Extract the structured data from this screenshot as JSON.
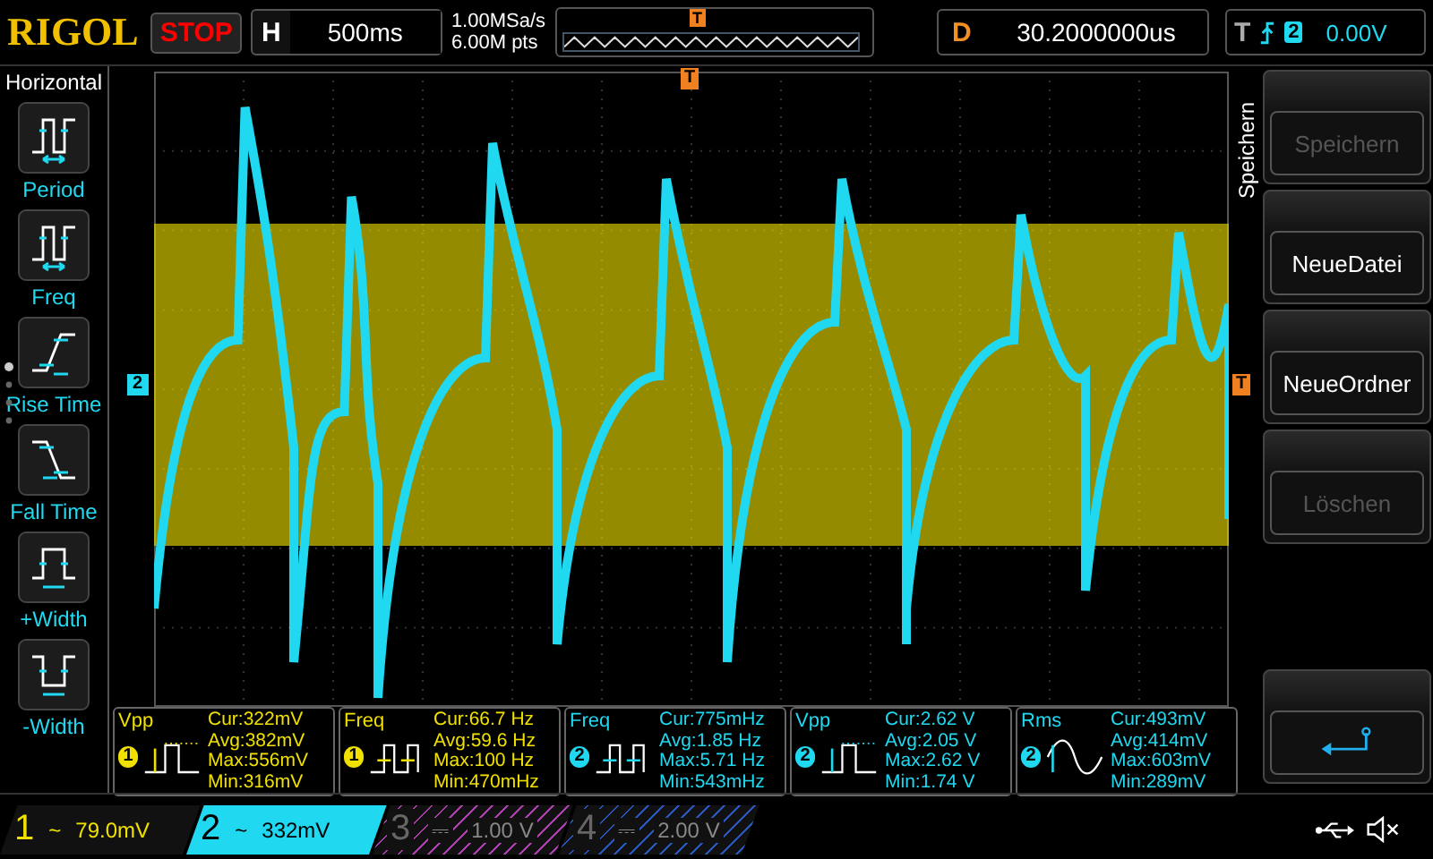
{
  "brand": "RIGOL",
  "run_state": "STOP",
  "timebase": {
    "label": "H",
    "value": "500ms"
  },
  "acquisition": {
    "sample_rate": "1.00MSa/s",
    "memory_depth": "6.00M pts"
  },
  "overview_marker": "T",
  "delay": {
    "label": "D",
    "value": "30.2000000us"
  },
  "trigger": {
    "label": "T",
    "source": "2",
    "level": "0.00V"
  },
  "left_menu": {
    "title": "Horizontal",
    "items": [
      {
        "label": "Period",
        "kind": "period"
      },
      {
        "label": "Freq",
        "kind": "freq"
      },
      {
        "label": "Rise Time",
        "kind": "rise"
      },
      {
        "label": "Fall Time",
        "kind": "fall"
      },
      {
        "label": "+Width",
        "kind": "pwidth"
      },
      {
        "label": "-Width",
        "kind": "nwidth"
      }
    ]
  },
  "screen_markers": {
    "channel": "2",
    "trigger_top": "T",
    "trigger_level": "T"
  },
  "right_menu": {
    "title": "Speichern",
    "buttons": [
      {
        "kind": "text",
        "label": "Speichern",
        "disabled": true
      },
      {
        "kind": "text",
        "label": "NeueDatei",
        "disabled": false
      },
      {
        "kind": "text",
        "label": "NeueOrdner",
        "disabled": false
      },
      {
        "kind": "text",
        "label": "Löschen",
        "disabled": true
      },
      {
        "kind": "back"
      }
    ]
  },
  "measurements": [
    {
      "name": "Vpp",
      "channel": "1",
      "color": "#f0e000",
      "kind": "pulse",
      "lines": [
        "Cur:322mV",
        "Avg:382mV",
        "Max:556mV",
        "Min:316mV"
      ]
    },
    {
      "name": "Freq",
      "channel": "1",
      "color": "#f0e000",
      "kind": "period",
      "lines": [
        "Cur:66.7 Hz",
        "Avg:59.6 Hz",
        "Max:100 Hz",
        "Min:470mHz"
      ]
    },
    {
      "name": "Freq",
      "channel": "2",
      "color": "#20d8f0",
      "kind": "period",
      "lines": [
        "Cur:775mHz",
        "Avg:1.85 Hz",
        "Max:5.71 Hz",
        "Min:543mHz"
      ]
    },
    {
      "name": "Vpp",
      "channel": "2",
      "color": "#20d8f0",
      "kind": "pulse",
      "lines": [
        "Cur:2.62 V",
        "Avg:2.05 V",
        "Max:2.62 V",
        "Min:1.74 V"
      ]
    },
    {
      "name": "Rms",
      "channel": "2",
      "color": "#20d8f0",
      "kind": "sine",
      "lines": [
        "Cur:493mV",
        "Avg:414mV",
        "Max:603mV",
        "Min:289mV"
      ]
    }
  ],
  "channels": [
    {
      "number": "1",
      "coupling": "~",
      "scale": "79.0mV",
      "on": true,
      "selected": false,
      "color": "#f0e000"
    },
    {
      "number": "2",
      "coupling": "~",
      "scale": "332mV",
      "on": true,
      "selected": true,
      "color": "#20d8f0"
    },
    {
      "number": "3",
      "coupling": "⎓",
      "scale": "1.00 V",
      "on": false,
      "selected": false,
      "color": "#b040b0"
    },
    {
      "number": "4",
      "coupling": "⎓",
      "scale": "2.00 V",
      "on": false,
      "selected": false,
      "color": "#2858c0"
    }
  ]
}
